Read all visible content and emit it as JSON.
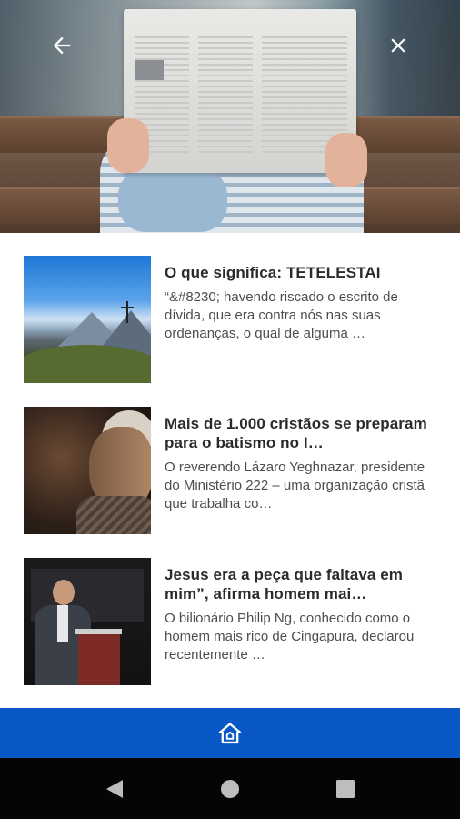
{
  "hero": {
    "back_icon": "arrow-left-icon",
    "close_icon": "close-icon"
  },
  "articles": [
    {
      "title": "O que significa: TETELESTAI",
      "summary": "“&#8230; havendo riscado o escrito de dívida, que era contra nós nas suas ordenanças, o qual de alguma …",
      "thumbnail": "mountain-cross-image"
    },
    {
      "title": "Mais de 1.000 cristãos se preparam para o batismo no I…",
      "summary": "O reverendo Lázaro Yeghnazar, presidente do Ministério 222  – uma organização cristã que trabalha co…",
      "thumbnail": "elderly-person-image"
    },
    {
      "title": "Jesus era a peça que faltava em mim”, afirma homem mai…",
      "summary": "O bilionário Philip Ng, conhecido como o homem mais rico de Cingapura, declarou recentemente …",
      "thumbnail": "speaker-podium-image"
    }
  ],
  "bottom_bar": {
    "home_icon": "home-icon",
    "color": "#0a58c8"
  },
  "system_nav": {
    "back_icon": "triangle-back-icon",
    "home_icon": "circle-home-icon",
    "recents_icon": "square-recents-icon"
  }
}
